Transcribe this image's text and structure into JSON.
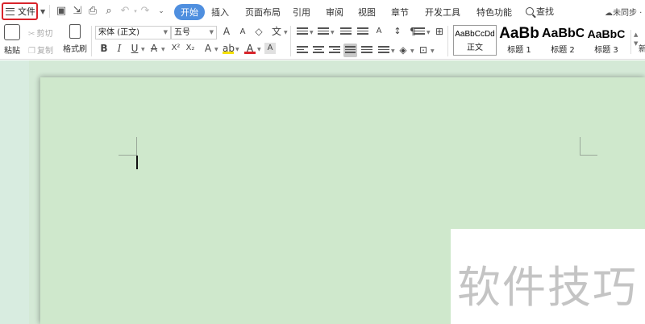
{
  "menubar": {
    "file_label": "文件",
    "tabs": [
      "开始",
      "插入",
      "页面布局",
      "引用",
      "审阅",
      "视图",
      "章节",
      "开发工具",
      "特色功能"
    ],
    "search_label": "查找",
    "sync_label": "未同步 ·"
  },
  "ribbon": {
    "paste_label": "粘贴",
    "cut_label": "剪切",
    "copy_label": "复制",
    "format_painter_label": "格式刷",
    "font_name": "宋体 (正文)",
    "font_size": "五号",
    "styles": [
      {
        "sample": "AaBbCcDd",
        "name": "正文"
      },
      {
        "sample": "AaBb",
        "name": "标题 1"
      },
      {
        "sample": "AaBbC",
        "name": "标题 2"
      },
      {
        "sample": "AaBbC",
        "name": "标题 3"
      }
    ],
    "new_style_label": "新"
  },
  "watermark": {
    "text": "软件技巧"
  },
  "colors": {
    "accent": "#4f8fdf",
    "file_border": "#d9242b",
    "page": "#cfe8cc",
    "workspace": "#d4e9d6"
  }
}
